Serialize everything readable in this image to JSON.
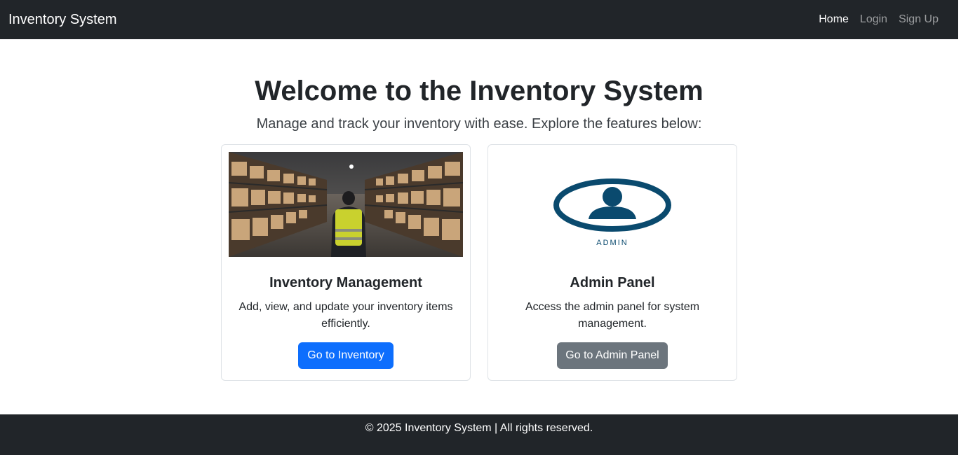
{
  "navbar": {
    "brand": "Inventory System",
    "links": [
      {
        "label": "Home",
        "active": true
      },
      {
        "label": "Login",
        "active": false
      },
      {
        "label": "Sign Up",
        "active": false
      }
    ]
  },
  "hero": {
    "title": "Welcome to the Inventory System",
    "subtitle": "Manage and track your inventory with ease. Explore the features below:"
  },
  "cards": [
    {
      "image": "warehouse-photo",
      "title": "Inventory Management",
      "text": "Add, view, and update your inventory items efficiently.",
      "button": "Go to Inventory"
    },
    {
      "image": "admin-icon",
      "image_text": "ADMIN",
      "title": "Admin Panel",
      "text": "Access the admin panel for system management.",
      "button": "Go to Admin Panel"
    }
  ],
  "footer": {
    "text": "© 2025 Inventory System | All rights reserved."
  },
  "colors": {
    "navbar_bg": "#212529",
    "primary": "#0d6efd",
    "secondary": "#6c757d",
    "admin_icon": "#0a4a6e"
  }
}
